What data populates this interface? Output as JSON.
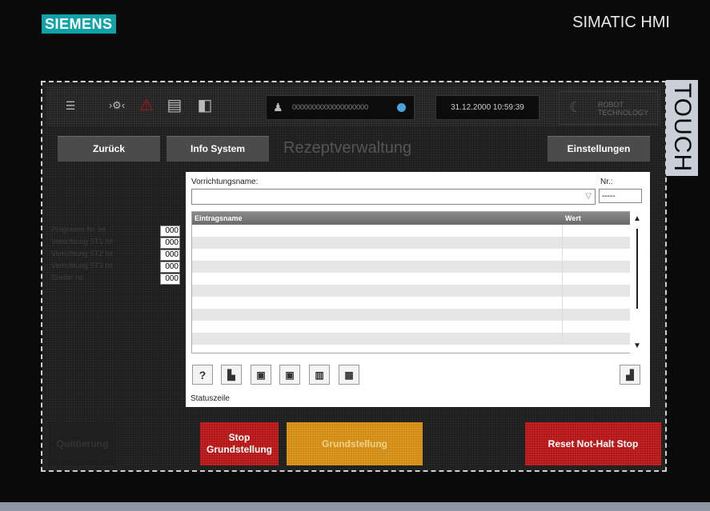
{
  "header": {
    "brand": "SIEMENS",
    "product": "SIMATIC HMI",
    "side_label": "TOUCH"
  },
  "topbar": {
    "icons": [
      "menu-icon",
      "robot-arm-icon",
      "warning-icon",
      "list-icon",
      "door-icon"
    ],
    "user_value": "0000000000000000000",
    "datetime": "31.12.2000 10:59:39",
    "robot_brand_line1": "ROBOT",
    "robot_brand_line2": "TECHNOLOGY"
  },
  "nav": {
    "back": "Zurück",
    "info": "Info System",
    "title": "Rezeptverwaltung",
    "settings": "Einstellungen"
  },
  "left_panel": {
    "items": [
      {
        "label": "Programm Nr. Ist",
        "value": "000"
      },
      {
        "label": "Vorrichtung ST1 Ist",
        "value": "000"
      },
      {
        "label": "Vorrichtung ST2 Ist",
        "value": "000"
      },
      {
        "label": "Vorrichtung ST3 Ist",
        "value": "000"
      },
      {
        "label": "Greifer Ist",
        "value": "000"
      }
    ]
  },
  "recipe": {
    "name_label": "Vorrichtungsname:",
    "nr_label": "Nr.:",
    "nr_value": "-----",
    "col_name": "Eintragsname",
    "col_value": "Wert",
    "status": "Statuszeile",
    "toolbar": [
      "help-icon",
      "new-recipe-icon",
      "save-icon",
      "save-as-icon",
      "delete-icon",
      "sync-icon"
    ],
    "help_glyph": "?"
  },
  "bottom": {
    "ack": "Quittierung",
    "stop": "Stop\nGrundstellung",
    "home": "Grundstellung",
    "reset": "Reset Not-Halt Stop"
  },
  "colors": {
    "brand": "#0fa3a9",
    "red": "#b01515",
    "orange": "#cc8a10"
  }
}
